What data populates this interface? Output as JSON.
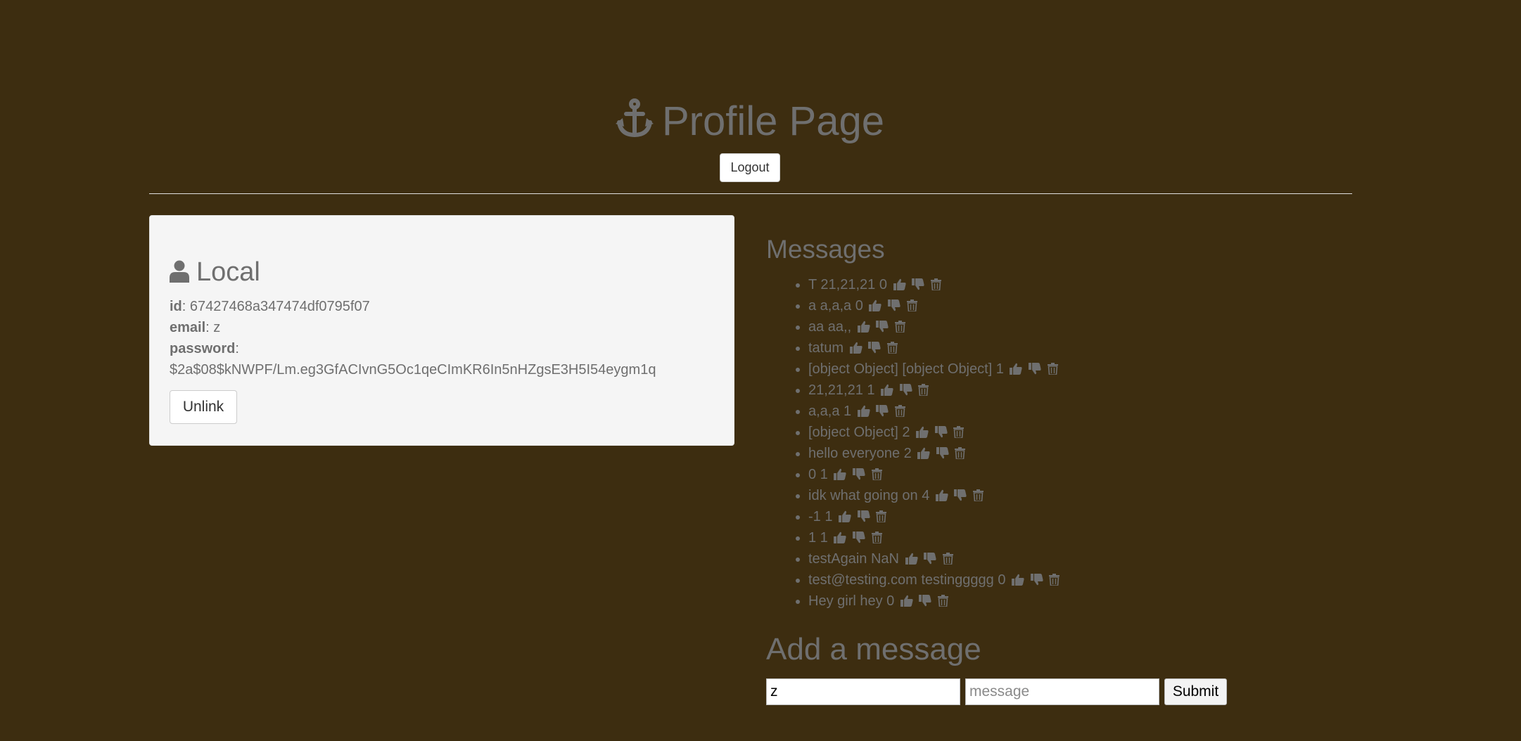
{
  "header": {
    "title": "Profile Page",
    "logout_label": "Logout"
  },
  "local": {
    "title": "Local",
    "id_label": "id",
    "id_value": "67427468a347474df0795f07",
    "email_label": "email",
    "email_value": "z",
    "password_label": "password",
    "password_value": "$2a$08$kNWPF/Lm.eg3GfACIvnG5Oc1qeCImKR6In5nHZgsE3H5I54eygm1q",
    "unlink_label": "Unlink"
  },
  "messages": {
    "title": "Messages",
    "items": [
      "T 21,21,21 0",
      "a a,a,a 0",
      "aa aa,,",
      "tatum",
      "[object Object] [object Object] 1",
      "21,21,21 1",
      "a,a,a 1",
      "[object Object] 2",
      "hello everyone 2",
      "0 1",
      "idk what going on 4",
      "-1 1",
      "1 1",
      "testAgain NaN",
      "test@testing.com testinggggg 0",
      "Hey girl hey 0"
    ]
  },
  "add_message": {
    "title": "Add a message",
    "name_value": "z",
    "message_placeholder": "message",
    "submit_label": "Submit"
  },
  "colors": {
    "background": "#3d2d10",
    "text": "#707070",
    "card": "#f5f5f5"
  },
  "icons": {
    "title_icon": "anchor-icon",
    "local_icon": "user-icon",
    "message_actions": [
      "thumbs-up-icon",
      "thumbs-down-icon",
      "trash-icon"
    ]
  }
}
